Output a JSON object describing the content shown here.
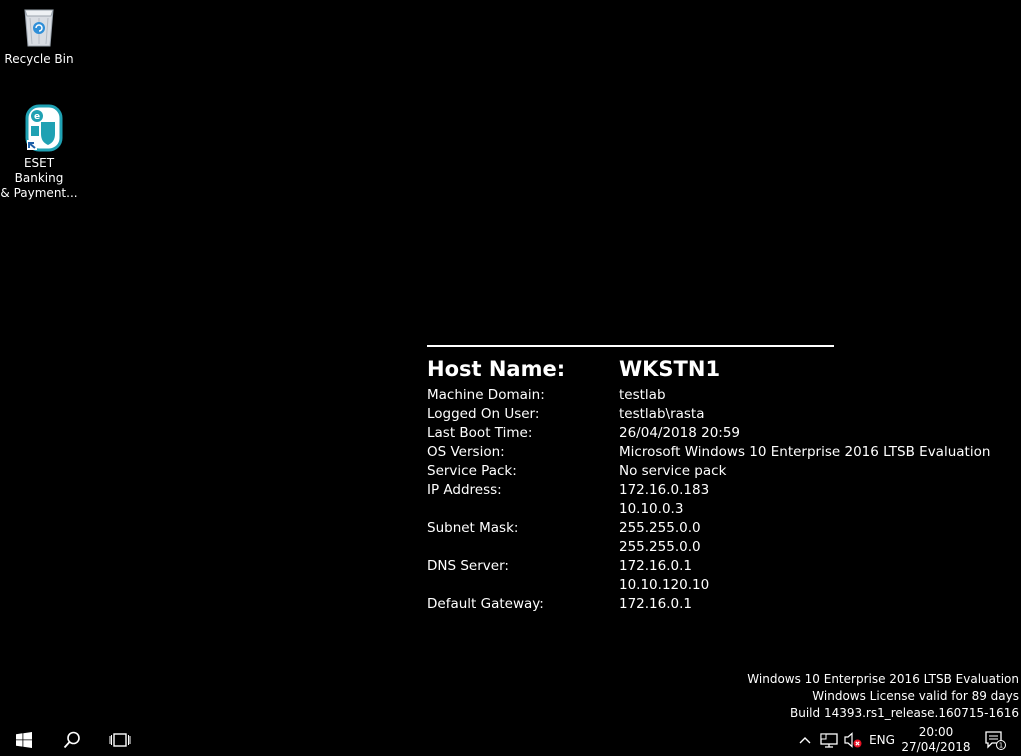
{
  "desktop": {
    "icons": [
      {
        "label": "Recycle Bin",
        "icon": "recycle-bin-icon"
      },
      {
        "label": "ESET Banking\n& Payment...",
        "icon": "eset-shield-icon"
      }
    ]
  },
  "bginfo": {
    "host_name_label": "Host Name:",
    "host_name_value": "WKSTN1",
    "rows": [
      {
        "label": "Machine Domain:",
        "value": "testlab"
      },
      {
        "label": "Logged On User:",
        "value": "testlab\\rasta"
      },
      {
        "label": "Last Boot Time:",
        "value": "26/04/2018 20:59"
      },
      {
        "label": "OS Version:",
        "value": "Microsoft Windows 10 Enterprise 2016 LTSB Evaluation"
      },
      {
        "label": "Service Pack:",
        "value": "No service pack"
      },
      {
        "label": "IP Address:",
        "value": "172.16.0.183"
      },
      {
        "label": "",
        "value": "10.10.0.3"
      },
      {
        "label": "Subnet Mask:",
        "value": "255.255.0.0"
      },
      {
        "label": "",
        "value": "255.255.0.0"
      },
      {
        "label": "DNS Server:",
        "value": "172.16.0.1"
      },
      {
        "label": "",
        "value": "10.10.120.10"
      },
      {
        "label": "Default Gateway:",
        "value": "172.16.0.1"
      }
    ]
  },
  "watermark": {
    "line1": "Windows 10 Enterprise 2016 LTSB Evaluation",
    "line2": "Windows License valid for 89 days",
    "line3": "Build 14393.rs1_release.160715-1616"
  },
  "taskbar": {
    "start_icon": "windows-logo-icon",
    "search_icon": "search-icon",
    "taskview_icon": "task-view-icon",
    "tray": {
      "chevron_icon": "chevron-up-icon",
      "network_icon": "network-icon",
      "volume_icon": "volume-muted-icon",
      "language": "ENG",
      "time": "20:00",
      "date": "27/04/2018",
      "notification_icon": "action-center-icon",
      "notification_count": "1"
    }
  },
  "colors": {
    "background": "#000000",
    "text": "#ffffff",
    "eset_teal": "#1fa1b3",
    "muted_red": "#e81123"
  }
}
